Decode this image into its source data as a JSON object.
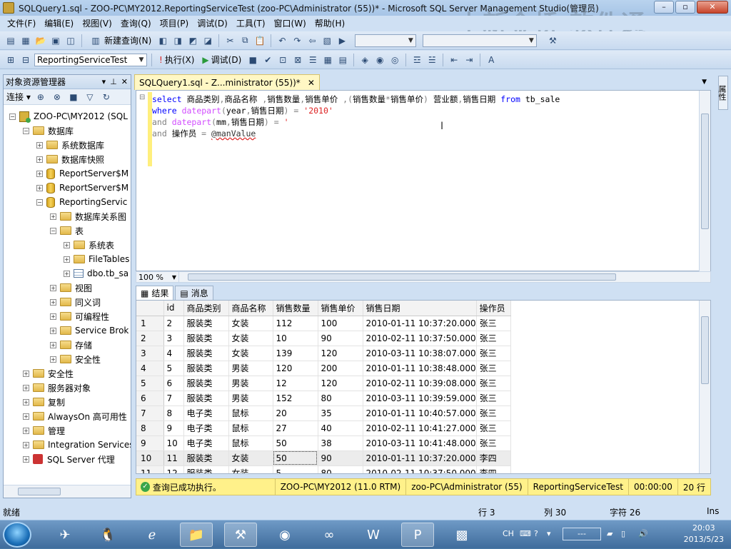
{
  "window": {
    "title": "SQLQuery1.sql - ZOO-PC\\MY2012.ReportingServiceTest (zoo-PC\\Administrator (55))* - Microsoft SQL Server Management Studio(管理员)",
    "watermark": "中新金桥 软件通"
  },
  "menu": [
    "文件(F)",
    "编辑(E)",
    "视图(V)",
    "查询(Q)",
    "项目(P)",
    "调试(D)",
    "工具(T)",
    "窗口(W)",
    "帮助(H)"
  ],
  "toolbar": {
    "new_query": "新建查询(N)",
    "database": "ReportingServiceTest",
    "execute": "执行(X)",
    "debug": "调试(D)"
  },
  "object_explorer": {
    "title": "对象资源管理器",
    "connect": "连接",
    "nodes": [
      {
        "label": "ZOO-PC\\MY2012 (SQL",
        "icon": "server-icon",
        "exp": "−"
      },
      {
        "label": "数据库",
        "icon": "folder-icon",
        "exp": "−"
      },
      {
        "label": "系统数据库",
        "icon": "folder-icon",
        "exp": "+"
      },
      {
        "label": "数据库快照",
        "icon": "folder-icon",
        "exp": "+"
      },
      {
        "label": "ReportServer$M",
        "icon": "database-icon",
        "exp": "+"
      },
      {
        "label": "ReportServer$M",
        "icon": "database-icon",
        "exp": "+"
      },
      {
        "label": "ReportingServic",
        "icon": "database-icon",
        "exp": "−"
      },
      {
        "label": "数据库关系图",
        "icon": "folder-icon",
        "exp": "+"
      },
      {
        "label": "表",
        "icon": "folder-icon",
        "exp": "−"
      },
      {
        "label": "系统表",
        "icon": "folder-icon",
        "exp": "+"
      },
      {
        "label": "FileTables",
        "icon": "folder-icon",
        "exp": "+"
      },
      {
        "label": "dbo.tb_sa",
        "icon": "table-icon",
        "exp": "+"
      },
      {
        "label": "视图",
        "icon": "folder-icon",
        "exp": "+"
      },
      {
        "label": "同义词",
        "icon": "folder-icon",
        "exp": "+"
      },
      {
        "label": "可编程性",
        "icon": "folder-icon",
        "exp": "+"
      },
      {
        "label": "Service Brok",
        "icon": "folder-icon",
        "exp": "+"
      },
      {
        "label": "存储",
        "icon": "folder-icon",
        "exp": "+"
      },
      {
        "label": "安全性",
        "icon": "folder-icon",
        "exp": "+"
      },
      {
        "label": "安全性",
        "icon": "folder-icon",
        "exp": "+"
      },
      {
        "label": "服务器对象",
        "icon": "folder-icon",
        "exp": "+"
      },
      {
        "label": "复制",
        "icon": "folder-icon",
        "exp": "+"
      },
      {
        "label": "AlwaysOn 高可用性",
        "icon": "folder-icon",
        "exp": "+"
      },
      {
        "label": "管理",
        "icon": "folder-icon",
        "exp": "+"
      },
      {
        "label": "Integration Services",
        "icon": "folder-icon",
        "exp": "+"
      },
      {
        "label": "SQL Server 代理",
        "icon": "sql-agent-icon",
        "exp": "+"
      }
    ]
  },
  "editor": {
    "tab_label": "SQLQuery1.sql - Z...ministrator (55))*",
    "zoom": "100 %"
  },
  "results": {
    "tab_results": "结果",
    "tab_messages": "消息",
    "columns": [
      "id",
      "商品类别",
      "商品名称",
      "销售数量",
      "销售单价",
      "销售日期",
      "操作员"
    ],
    "rows": [
      [
        "1",
        "2",
        "服装类",
        "女装",
        "112",
        "100",
        "2010-01-11 10:37:20.000",
        "张三"
      ],
      [
        "2",
        "3",
        "服装类",
        "女装",
        "10",
        "90",
        "2010-02-11 10:37:50.000",
        "张三"
      ],
      [
        "3",
        "4",
        "服装类",
        "女装",
        "139",
        "120",
        "2010-03-11 10:38:07.000",
        "张三"
      ],
      [
        "4",
        "5",
        "服装类",
        "男装",
        "120",
        "200",
        "2010-01-11 10:38:48.000",
        "张三"
      ],
      [
        "5",
        "6",
        "服装类",
        "男装",
        "12",
        "120",
        "2010-02-11 10:39:08.000",
        "张三"
      ],
      [
        "6",
        "7",
        "服装类",
        "男装",
        "152",
        "80",
        "2010-03-11 10:39:59.000",
        "张三"
      ],
      [
        "7",
        "8",
        "电子类",
        "鼠标",
        "20",
        "35",
        "2010-01-11 10:40:57.000",
        "张三"
      ],
      [
        "8",
        "9",
        "电子类",
        "鼠标",
        "27",
        "40",
        "2010-02-11 10:41:27.000",
        "张三"
      ],
      [
        "9",
        "10",
        "电子类",
        "鼠标",
        "50",
        "38",
        "2010-03-11 10:41:48.000",
        "张三"
      ],
      [
        "10",
        "11",
        "服装类",
        "女装",
        "50",
        "90",
        "2010-01-11 10:37:20.000",
        "李四"
      ],
      [
        "11",
        "12",
        "服装类",
        "女装",
        "5",
        "80",
        "2010-02-11 10:37:50.000",
        "李四"
      ]
    ]
  },
  "query_status": {
    "message": "查询已成功执行。",
    "server": "ZOO-PC\\MY2012 (11.0 RTM)",
    "user": "zoo-PC\\Administrator (55)",
    "database": "ReportingServiceTest",
    "elapsed": "00:00:00",
    "rows": "20 行"
  },
  "statusbar": {
    "ready": "就绪",
    "line": "行 3",
    "col": "列 30",
    "char": "字符 26",
    "mode": "Ins"
  },
  "taskbar": {
    "lang": "CH",
    "time": "20:03",
    "date": "2013/5/23"
  },
  "right_strip": {
    "label": "属性"
  }
}
